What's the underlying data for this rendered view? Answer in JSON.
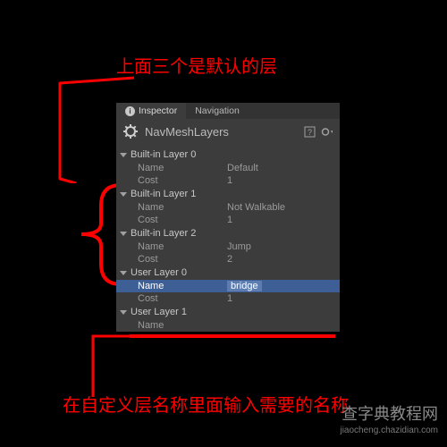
{
  "annotations": {
    "top": "上面三个是默认的层",
    "bottom": "在自定义层名称里面输入需要的名称"
  },
  "watermark": {
    "line1": "查字典教程网",
    "line2": "jiaocheng.chazidian.com"
  },
  "panel": {
    "tabs": {
      "inspector": "Inspector",
      "navigation": "Navigation"
    },
    "title": "NavMeshLayers",
    "layers": [
      {
        "head": "Built-in Layer 0",
        "name_label": "Name",
        "name_value": "Default",
        "cost_label": "Cost",
        "cost_value": "1"
      },
      {
        "head": "Built-in Layer 1",
        "name_label": "Name",
        "name_value": "Not Walkable",
        "cost_label": "Cost",
        "cost_value": "1"
      },
      {
        "head": "Built-in Layer 2",
        "name_label": "Name",
        "name_value": "Jump",
        "cost_label": "Cost",
        "cost_value": "2"
      },
      {
        "head": "User Layer 0",
        "name_label": "Name",
        "name_value": "bridge",
        "cost_label": "Cost",
        "cost_value": "1",
        "selected": true
      },
      {
        "head": "User Layer 1",
        "name_label": "Name",
        "name_value": ""
      }
    ]
  }
}
